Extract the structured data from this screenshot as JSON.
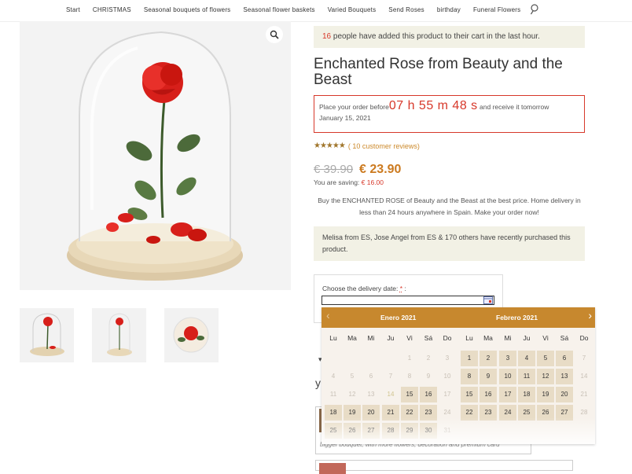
{
  "nav": {
    "items": [
      "Start",
      "CHRISTMAS",
      "Seasonal bouquets of flowers",
      "Seasonal flower baskets",
      "Varied Bouquets",
      "Send Roses",
      "birthday",
      "Funeral Flowers"
    ]
  },
  "product": {
    "cart_count": "16",
    "cart_notice_text": " people have added this product to their cart in the last hour.",
    "title": "Enchanted Rose from Beauty and the Beast",
    "countdown_prefix": "Place your order before",
    "countdown_timer": "07 h 55 m 48 s",
    "countdown_suffix": " and receive it tomorrow",
    "countdown_date": "January 15, 2021",
    "review_link": "( 10 customer reviews)",
    "old_price": "€ 39.90",
    "new_price": "€ 23.90",
    "saving_label": "You are saving: ",
    "saving_amount": "€ 16.00",
    "description": "Buy the ENCHANTED ROSE of Beauty and the Beast at the best price. Home delivery in less than 24 hours anywhere in Spain. Make your order now!",
    "recent_purchase": "Melisa from ES, Jose Angel from ES & 170 others have recently purchased this product.",
    "delivery_label": "Choose the delivery date:",
    "delivery_required": "*",
    "delivery_colon": ":"
  },
  "behind": {
    "line0": "▾",
    "line1": "y",
    "card_caption": "bigger bouquet, with more flowers, decoration and premium card"
  },
  "calendar": {
    "month1": "Enero 2021",
    "month2": "Febrero 2021",
    "dow": [
      "Lu",
      "Ma",
      "Mi",
      "Ju",
      "Vi",
      "Sá",
      "Do"
    ]
  },
  "colors": {
    "accent_red": "#d7382a",
    "price_orange": "#cc7a1f",
    "calendar_header": "#c7882e",
    "notice_bg": "#f2f1e5"
  }
}
